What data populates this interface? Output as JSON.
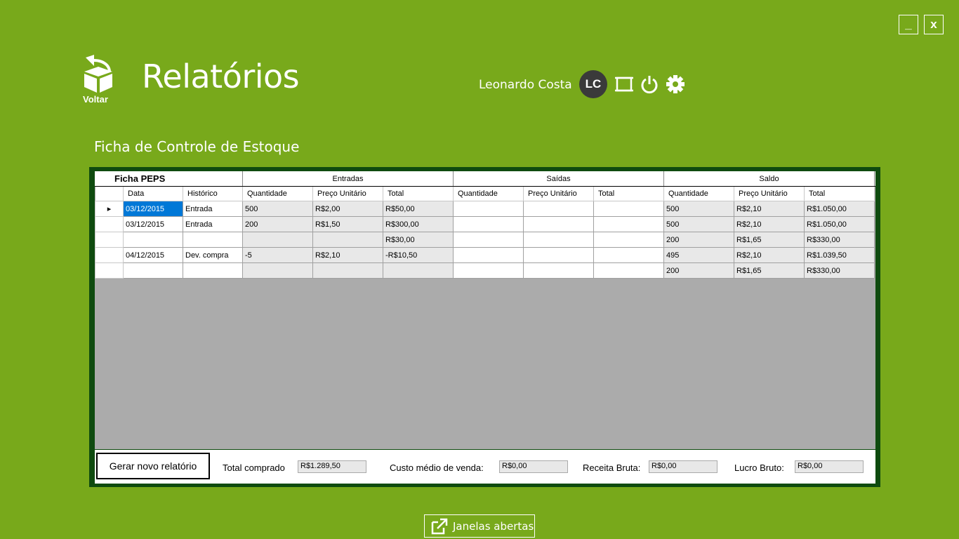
{
  "window": {
    "minimize_label": "_",
    "close_label": "x"
  },
  "header": {
    "back_label": "Voltar",
    "title": "Relatórios",
    "user_name": "Leonardo Costa",
    "avatar_initials": "LC"
  },
  "section_title": "Ficha de Controle de Estoque",
  "grid": {
    "group_headers": [
      "Ficha PEPS",
      "Entradas",
      "Saídas",
      "Saldo"
    ],
    "columns": [
      "Data",
      "Histórico",
      "Quantidade",
      "Preço Unitário",
      "Total",
      "Quantidade",
      "Preço Unitário",
      "Total",
      "Quantidade",
      "Preço Unitário",
      "Total"
    ],
    "rows": [
      [
        "03/12/2015",
        "Entrada",
        "500",
        "R$2,00",
        "R$50,00",
        "",
        "",
        "",
        "500",
        "R$2,10",
        "R$1.050,00"
      ],
      [
        "03/12/2015",
        "Entrada",
        "200",
        "R$1,50",
        "R$300,00",
        "",
        "",
        "",
        "500",
        "R$2,10",
        "R$1.050,00"
      ],
      [
        "",
        "",
        "",
        "",
        "R$30,00",
        "",
        "",
        "",
        "200",
        "R$1,65",
        "R$330,00"
      ],
      [
        "04/12/2015",
        "Dev. compra",
        "-5",
        "R$2,10",
        "-R$10,50",
        "",
        "",
        "",
        "495",
        "R$2,10",
        "R$1.039,50"
      ],
      [
        "",
        "",
        "",
        "",
        "",
        "",
        "",
        "",
        "200",
        "R$1,65",
        "R$330,00"
      ]
    ]
  },
  "footer": {
    "generate_button": "Gerar novo relatório",
    "total_comprado_label": "Total comprado",
    "total_comprado_value": "R$1.289,50",
    "custo_medio_label": "Custo médio de venda:",
    "custo_medio_value": "R$0,00",
    "receita_label": "Receita Bruta:",
    "receita_value": "R$0,00",
    "lucro_label": "Lucro Bruto:",
    "lucro_value": "R$0,00"
  },
  "open_windows_label": "Janelas abertas",
  "colors": {
    "background": "#78a91b",
    "frame": "#0f4b0f",
    "selection": "#0078d7"
  }
}
